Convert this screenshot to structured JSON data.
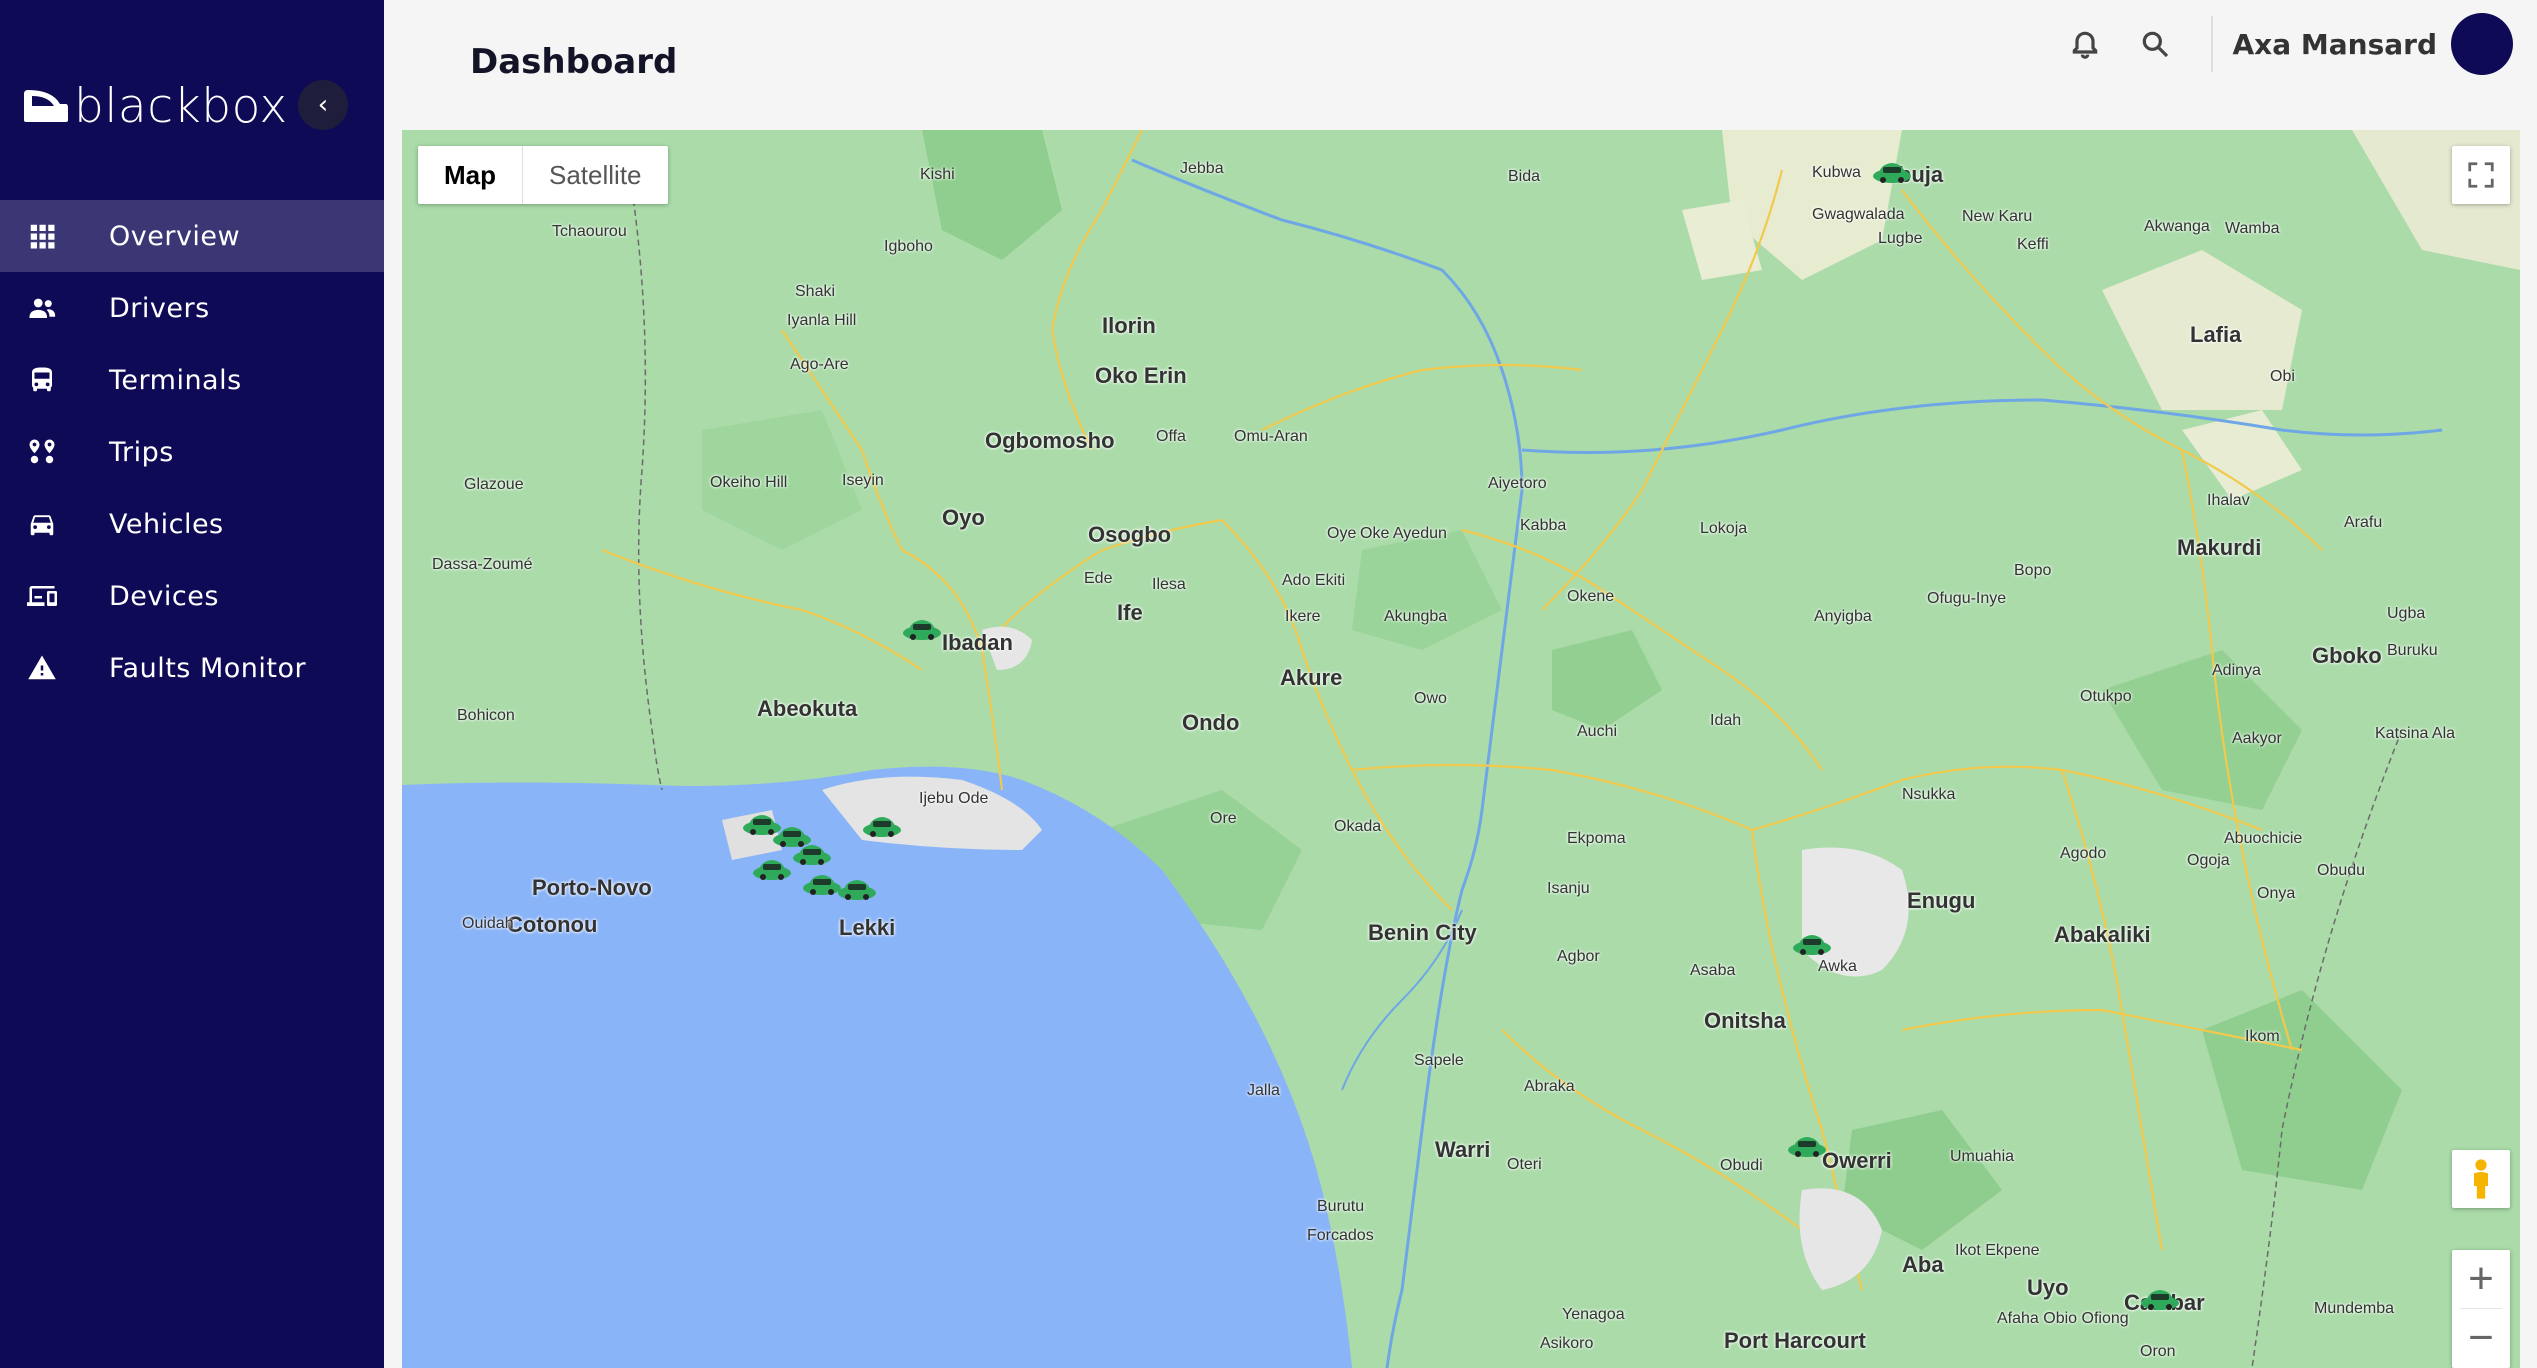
{
  "brand": {
    "name": "blackbox"
  },
  "sidebar": {
    "items": [
      {
        "label": "Overview",
        "icon": "grid-icon",
        "active": true
      },
      {
        "label": "Drivers",
        "icon": "people-icon",
        "active": false
      },
      {
        "label": "Terminals",
        "icon": "bus-icon",
        "active": false
      },
      {
        "label": "Trips",
        "icon": "route-icon",
        "active": false
      },
      {
        "label": "Vehicles",
        "icon": "car-icon",
        "active": false
      },
      {
        "label": "Devices",
        "icon": "devices-icon",
        "active": false
      },
      {
        "label": "Faults Monitor",
        "icon": "warning-icon",
        "active": false
      }
    ]
  },
  "header": {
    "title": "Dashboard",
    "user_name": "Axa Mansard"
  },
  "map": {
    "type_buttons": [
      "Map",
      "Satellite"
    ],
    "selected_type": "Map",
    "zoom_in": "+",
    "zoom_out": "−",
    "places": [
      {
        "name": "Abuja",
        "weight": "big"
      },
      {
        "name": "Kubwa",
        "weight": "small"
      },
      {
        "name": "Ilorin",
        "weight": "big"
      },
      {
        "name": "Oko Erin",
        "weight": "big"
      },
      {
        "name": "Ogbomosho",
        "weight": "big"
      },
      {
        "name": "Oyo",
        "weight": "big"
      },
      {
        "name": "Osogbo",
        "weight": "big"
      },
      {
        "name": "Ibadan",
        "weight": "big"
      },
      {
        "name": "Abeokuta",
        "weight": "big"
      },
      {
        "name": "Ife",
        "weight": "big"
      },
      {
        "name": "Akure",
        "weight": "big"
      },
      {
        "name": "Ondo",
        "weight": "big"
      },
      {
        "name": "Porto-Novo",
        "weight": "big"
      },
      {
        "name": "Cotonou",
        "weight": "big"
      },
      {
        "name": "Lekki",
        "weight": "big"
      },
      {
        "name": "Benin City",
        "weight": "big"
      },
      {
        "name": "Onitsha",
        "weight": "big"
      },
      {
        "name": "Enugu",
        "weight": "big"
      },
      {
        "name": "Abakaliki",
        "weight": "big"
      },
      {
        "name": "Lafia",
        "weight": "big"
      },
      {
        "name": "Makurdi",
        "weight": "big"
      },
      {
        "name": "Gboko",
        "weight": "big"
      },
      {
        "name": "Warri",
        "weight": "big"
      },
      {
        "name": "Owerri",
        "weight": "big"
      },
      {
        "name": "Aba",
        "weight": "big"
      },
      {
        "name": "Uyo",
        "weight": "big"
      },
      {
        "name": "Port Harcourt",
        "weight": "big"
      },
      {
        "name": "Calabar",
        "weight": "big"
      },
      {
        "name": "Lokoja",
        "weight": "small"
      },
      {
        "name": "Kabba",
        "weight": "small"
      },
      {
        "name": "Awka",
        "weight": "small"
      },
      {
        "name": "Nsukka",
        "weight": "small"
      },
      {
        "name": "Ijebu Ode",
        "weight": "small"
      },
      {
        "name": "Okada",
        "weight": "small"
      },
      {
        "name": "Auchi",
        "weight": "small"
      },
      {
        "name": "Idah",
        "weight": "small"
      },
      {
        "name": "Ikom",
        "weight": "small"
      },
      {
        "name": "Mundemba",
        "weight": "small"
      },
      {
        "name": "Sapele",
        "weight": "small"
      },
      {
        "name": "Jalla",
        "weight": "small"
      },
      {
        "name": "Forcados",
        "weight": "small"
      },
      {
        "name": "Ilesa",
        "weight": "small"
      },
      {
        "name": "Ede",
        "weight": "small"
      },
      {
        "name": "Iseyin",
        "weight": "small"
      },
      {
        "name": "Shaki",
        "weight": "small"
      },
      {
        "name": "Kishi",
        "weight": "small"
      },
      {
        "name": "Jebba",
        "weight": "small"
      },
      {
        "name": "Bida",
        "weight": "small"
      },
      {
        "name": "Keffi",
        "weight": "small"
      },
      {
        "name": "Gwagwalada",
        "weight": "small"
      },
      {
        "name": "Lugbe",
        "weight": "small"
      },
      {
        "name": "New Karu",
        "weight": "small"
      },
      {
        "name": "Akwanga",
        "weight": "small"
      },
      {
        "name": "Wamba",
        "weight": "small"
      },
      {
        "name": "Obi",
        "weight": "small"
      },
      {
        "name": "Ihalav",
        "weight": "small"
      },
      {
        "name": "Arafu",
        "weight": "small"
      },
      {
        "name": "Bopo",
        "weight": "small"
      },
      {
        "name": "Anyigba",
        "weight": "small"
      },
      {
        "name": "Ofugu-Inye",
        "weight": "small"
      },
      {
        "name": "Adinya",
        "weight": "small"
      },
      {
        "name": "Otukpo",
        "weight": "small"
      },
      {
        "name": "Ugba",
        "weight": "small"
      },
      {
        "name": "Buruku",
        "weight": "small"
      },
      {
        "name": "Aakyor",
        "weight": "small"
      },
      {
        "name": "Katsina Ala",
        "weight": "small"
      },
      {
        "name": "Agodo",
        "weight": "small"
      },
      {
        "name": "Abuochicie",
        "weight": "small"
      },
      {
        "name": "Ogoja",
        "weight": "small"
      },
      {
        "name": "Obudu",
        "weight": "small"
      },
      {
        "name": "Onya",
        "weight": "small"
      },
      {
        "name": "Ekpoma",
        "weight": "small"
      },
      {
        "name": "Isanju",
        "weight": "small"
      },
      {
        "name": "Agbor",
        "weight": "small"
      },
      {
        "name": "Asaba",
        "weight": "small"
      },
      {
        "name": "Abraka",
        "weight": "small"
      },
      {
        "name": "Oteri",
        "weight": "small"
      },
      {
        "name": "Burutu",
        "weight": "small"
      },
      {
        "name": "Obudi",
        "weight": "small"
      },
      {
        "name": "Umuahia",
        "weight": "small"
      },
      {
        "name": "Ikot Ekpene",
        "weight": "small"
      },
      {
        "name": "Afaha Obio Ofiong",
        "weight": "small"
      },
      {
        "name": "Oron",
        "weight": "small"
      },
      {
        "name": "Yenagoa",
        "weight": "small"
      },
      {
        "name": "Asikoro",
        "weight": "small"
      },
      {
        "name": "Igboho",
        "weight": "small"
      },
      {
        "name": "Iyanla Hill",
        "weight": "small"
      },
      {
        "name": "Ago-Are",
        "weight": "small"
      },
      {
        "name": "Okeiho Hill",
        "weight": "small"
      },
      {
        "name": "Glazoue",
        "weight": "small"
      },
      {
        "name": "Dassa-Zoumé",
        "weight": "small"
      },
      {
        "name": "Bohicon",
        "weight": "small"
      },
      {
        "name": "Ouidah",
        "weight": "small"
      },
      {
        "name": "Tchaourou",
        "weight": "small"
      },
      {
        "name": "Offa",
        "weight": "small"
      },
      {
        "name": "Omu-Aran",
        "weight": "small"
      },
      {
        "name": "Aiyetoro",
        "weight": "small"
      },
      {
        "name": "Oye",
        "weight": "small"
      },
      {
        "name": "Oke Ayedun",
        "weight": "small"
      },
      {
        "name": "Ado Ekiti",
        "weight": "small"
      },
      {
        "name": "Ikere",
        "weight": "small"
      },
      {
        "name": "Akungba",
        "weight": "small"
      },
      {
        "name": "Okene",
        "weight": "small"
      },
      {
        "name": "Owo",
        "weight": "small"
      },
      {
        "name": "Ore",
        "weight": "small"
      }
    ],
    "cars": [
      {
        "id": "car-abuja"
      },
      {
        "id": "car-ibadan"
      },
      {
        "id": "car-lagos-1"
      },
      {
        "id": "car-lagos-2"
      },
      {
        "id": "car-lagos-3"
      },
      {
        "id": "car-lagos-4"
      },
      {
        "id": "car-lagos-5"
      },
      {
        "id": "car-lagos-6"
      },
      {
        "id": "car-lagos-7"
      },
      {
        "id": "car-awka"
      },
      {
        "id": "car-owerri"
      },
      {
        "id": "car-calabar"
      }
    ]
  }
}
